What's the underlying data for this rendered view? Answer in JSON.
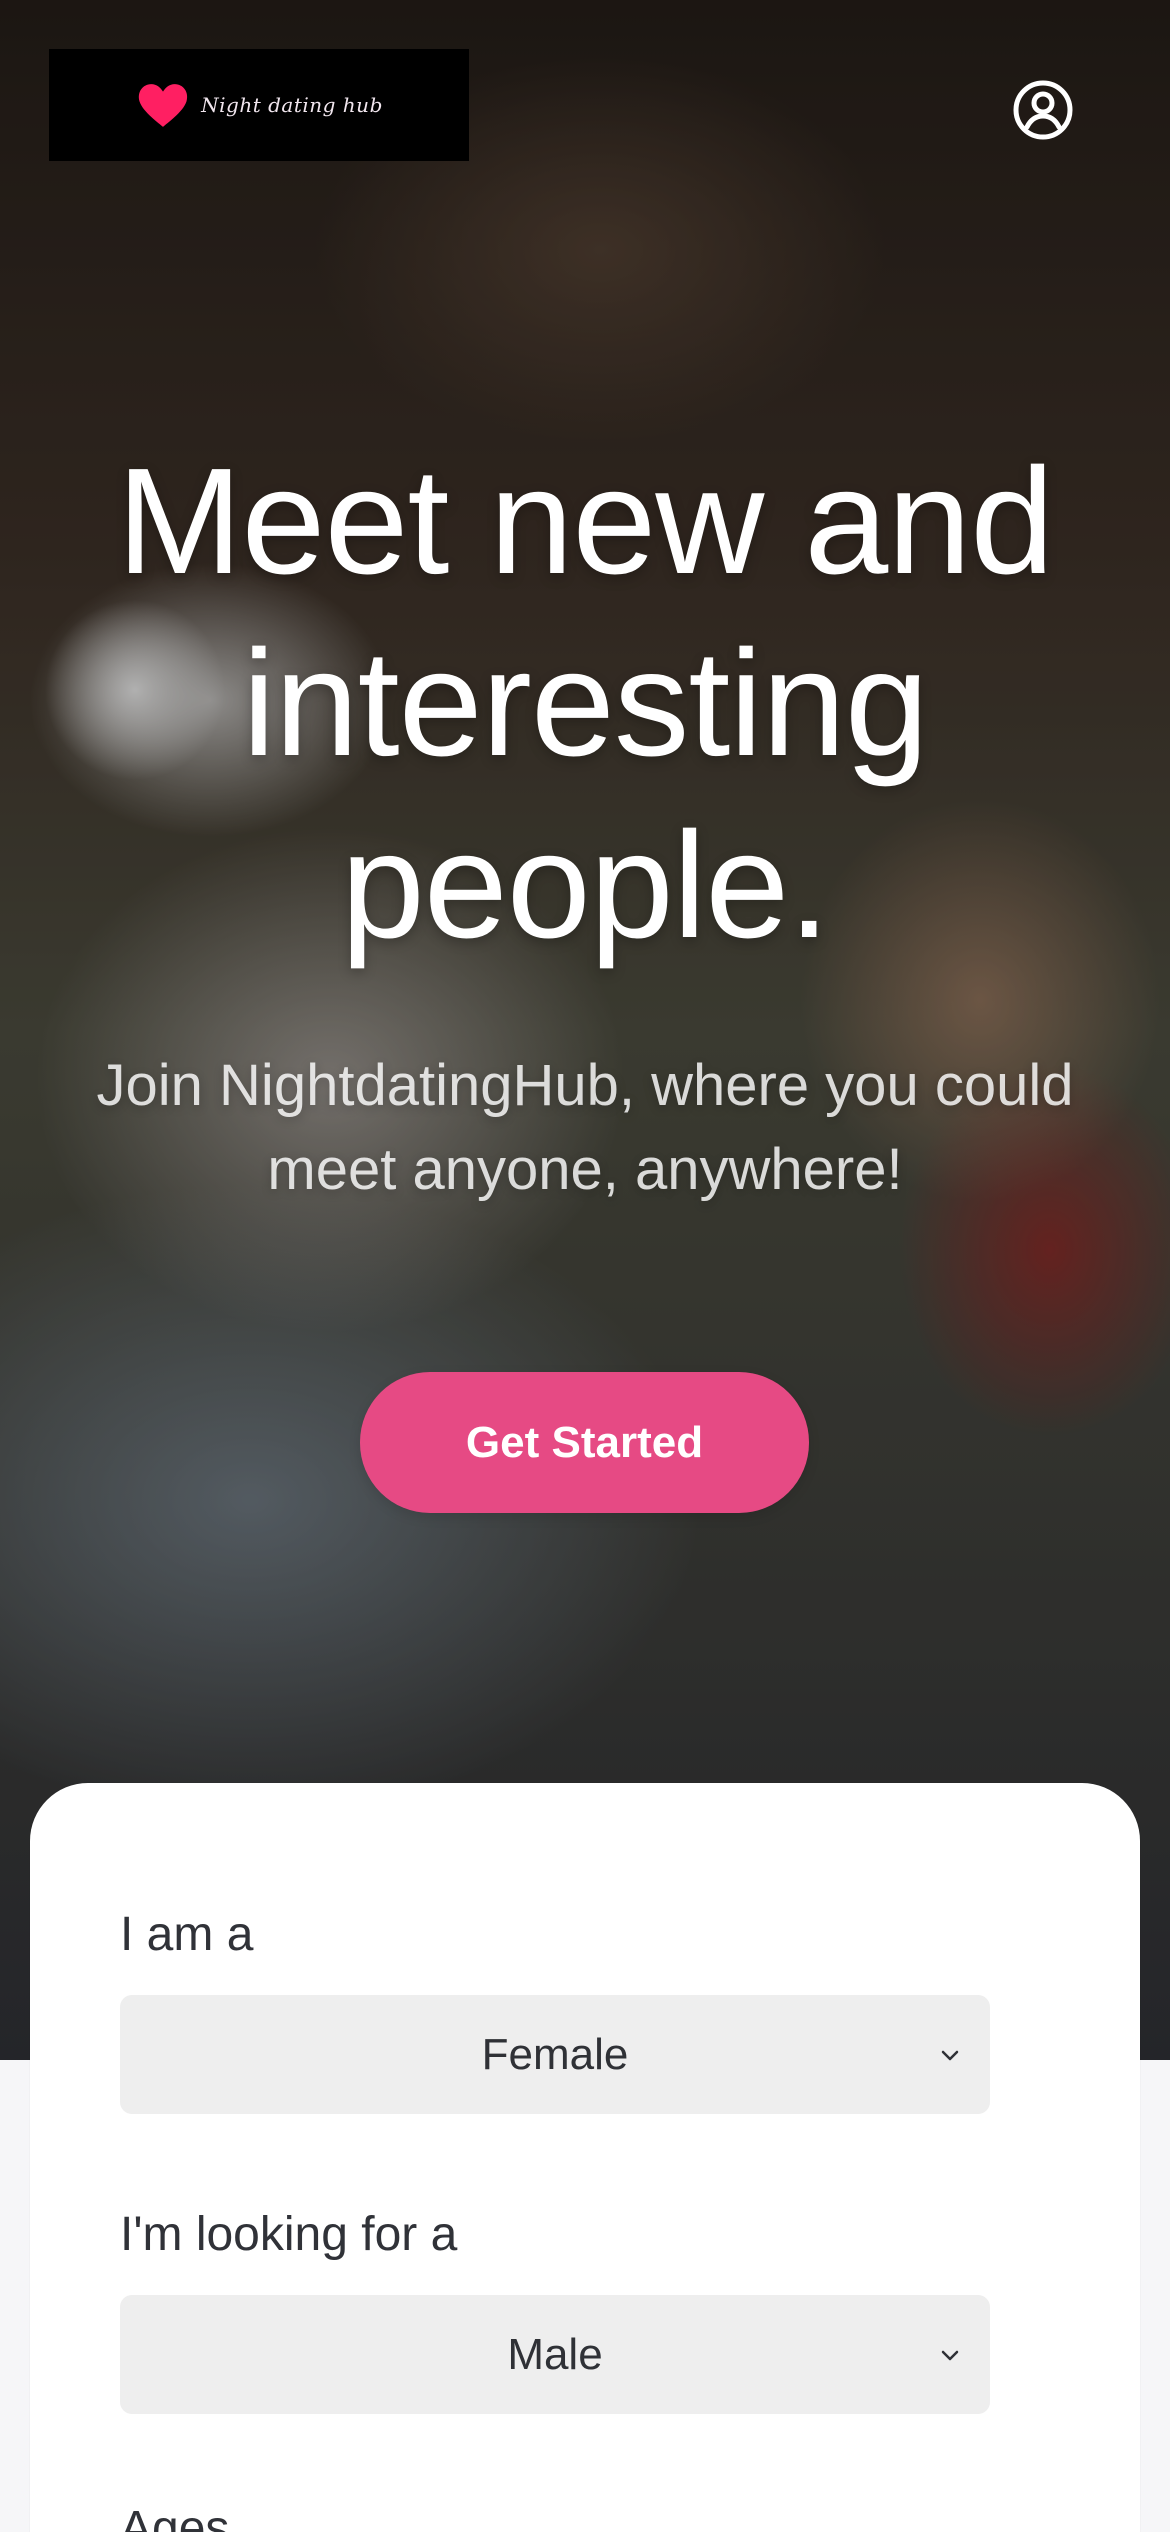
{
  "brand": {
    "logo_text": "Night dating hub"
  },
  "hero": {
    "title": "Meet new and interesting people.",
    "subtitle": "Join NightdatingHub, where you could meet anyone, anywhere!",
    "cta_label": "Get Started"
  },
  "form": {
    "i_am_label": "I am a",
    "i_am_value": "Female",
    "looking_for_label": "I'm looking for a",
    "looking_for_value": "Male",
    "ages_label": "Ages"
  },
  "icons": {
    "profile": "account-circle-icon",
    "dropdown": "chevron-down-icon",
    "logo_mark": "heart-icon"
  },
  "colors": {
    "cta": "#e64a84",
    "logo_heart": "#ff1f62",
    "card": "#ffffff",
    "select_bg": "#eeeeee"
  }
}
